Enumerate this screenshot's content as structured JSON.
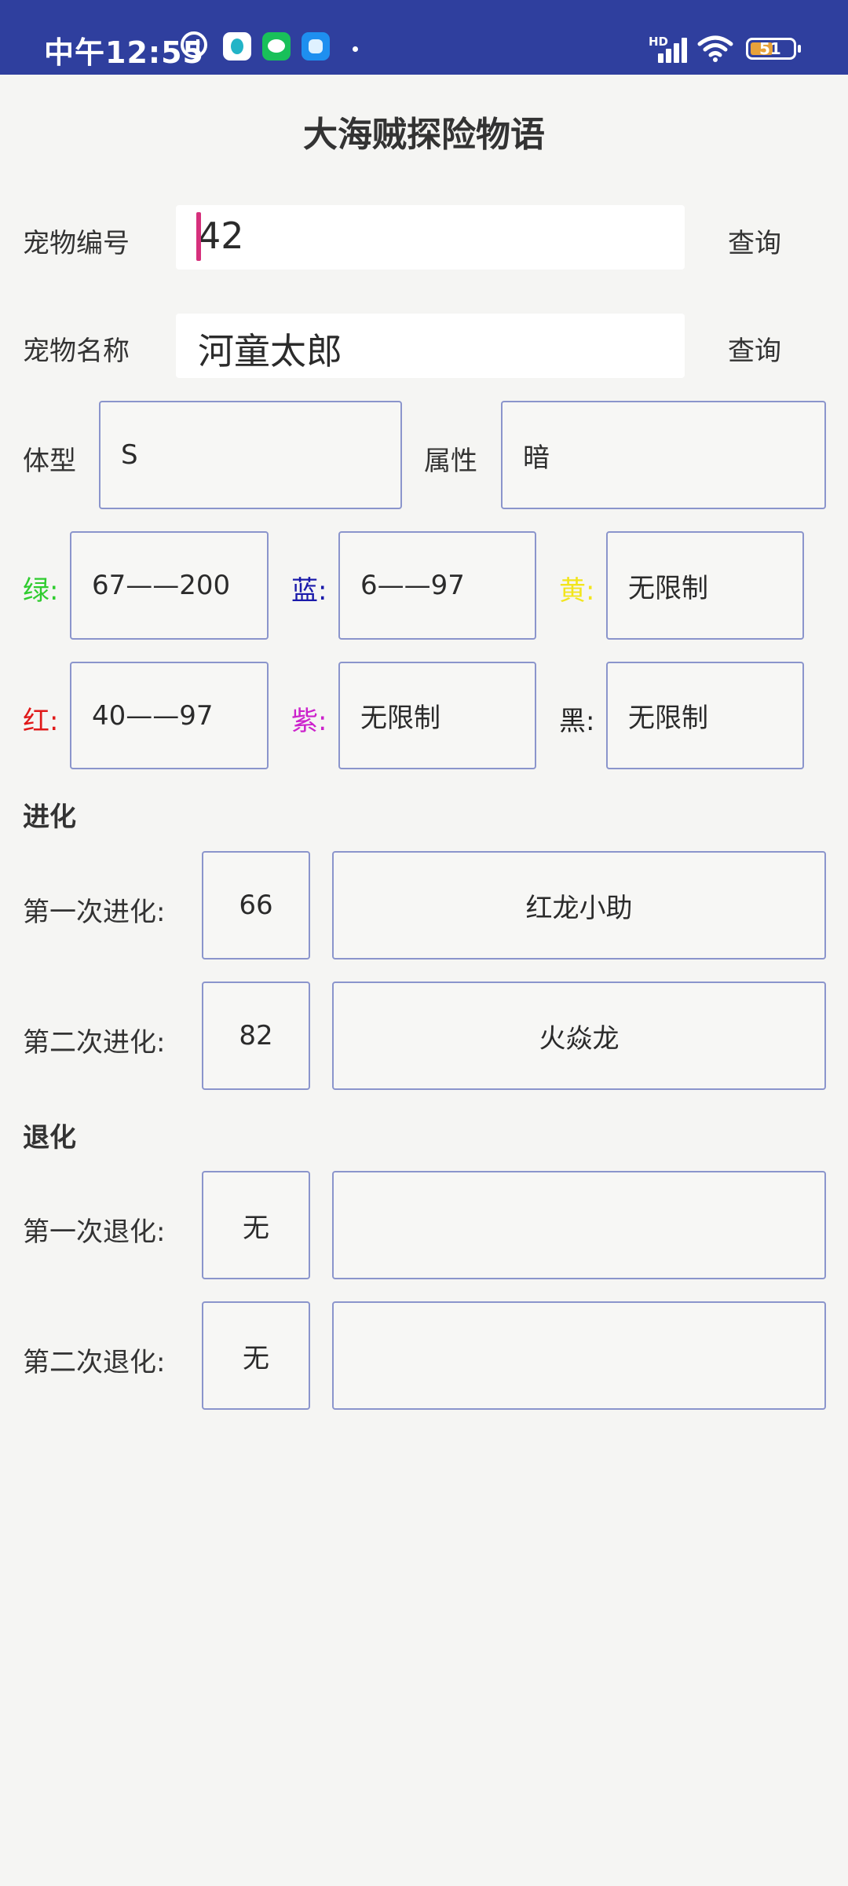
{
  "status_bar": {
    "time": "中午12:55",
    "battery": "51",
    "hd": "HD"
  },
  "app": {
    "title": "大海贼探险物语"
  },
  "search": {
    "pet_id_label": "宠物编号",
    "pet_id_value": "42",
    "pet_name_label": "宠物名称",
    "pet_name_value": "河童太郎",
    "query_label": "查询"
  },
  "info": {
    "size_label": "体型",
    "size_value": "S",
    "attr_label": "属性",
    "attr_value": "暗"
  },
  "colors": [
    {
      "label": "绿:",
      "value": "67——200",
      "color": "#2fcc2f"
    },
    {
      "label": "蓝:",
      "value": "6——97",
      "color": "#1a1aaa"
    },
    {
      "label": "黄:",
      "value": "无限制",
      "color": "#f2e51c"
    },
    {
      "label": "红:",
      "value": "40——97",
      "color": "#e01919"
    },
    {
      "label": "紫:",
      "value": "无限制",
      "color": "#cc22cc"
    },
    {
      "label": "黑:",
      "value": "无限制",
      "color": "#222222"
    }
  ],
  "evolution": {
    "title": "进化",
    "rows": [
      {
        "label": "第一次进化:",
        "level": "66",
        "name": "红龙小助"
      },
      {
        "label": "第二次进化:",
        "level": "82",
        "name": "火焱龙"
      }
    ]
  },
  "devolution": {
    "title": "退化",
    "rows": [
      {
        "label": "第一次退化:",
        "level": "无",
        "name": ""
      },
      {
        "label": "第二次退化:",
        "level": "无",
        "name": ""
      }
    ]
  }
}
